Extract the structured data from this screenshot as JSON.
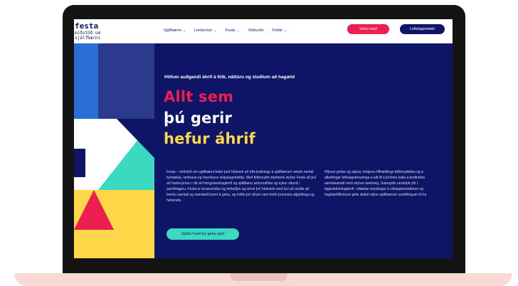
{
  "header": {
    "logo_title": "festa",
    "logo_subtitle_line1": "miðstöð um",
    "logo_subtitle_line2": "sjálfbærni",
    "nav": [
      {
        "label": "Sjálfbærni"
      },
      {
        "label": "Leiðarvísir"
      },
      {
        "label": "Festa"
      },
      {
        "label": "Viðburðir"
      },
      {
        "label": "Fréttir"
      }
    ],
    "join_button": "Vertu með",
    "climate_button": "Loftslagsmælir"
  },
  "hero": {
    "tagline": "Höfum auðgandi áhrif á fólk, náttúru og stuðlum að hagæld",
    "headline_line1": "Allt sem",
    "headline_line2": "þú gerir",
    "headline_line3": "hefur áhrif",
    "paragraph_left": "Festa – miðstöð um sjálfbærni hefur það hlutverk að efla þekkingu á sjálfbærum rekstri meðal fyrirtækja, stofnana og hverskyns skipulagsheilda. Með fjölbreyttri starfsemi styður Festa að því að hraða þróun í átt að hringrásarhagkerfi og sjálfbæru atvinnulífinu og eykur vitund í samfélaginu. Festa er brúarsmiður og leiðarljós og sinnir því hlutverki með því að stuðla að breiðu samtali og samstarfi þvert á geira, og miðla því áfram sem leiðir þróunina alþjóðlega og hérlendis.",
    "paragraph_right_lines": [
      "Hlýnun jarðar og sjávar, hnignun líffræðilegs fjölbreytileika og a",
      "afleiðingar loftslagsbreytinga á allt líf á jörðinni kalla á kraftmikla",
      "samtakamátt með skýran ásetning. Samspilin umskipti yfir í",
      "lágkolefnishagkerfi, róttækar breytingar á viðskiptamódelum og",
      "hagfræðilíkönum gefa skilað okkur sjálfbærum samfélögum til fra"
    ],
    "cta": "Sjáðu hvað þú getur gert"
  },
  "colors": {
    "navy": "#0e1566",
    "pink": "#ee1e50",
    "teal": "#3ad9c0",
    "yellow": "#ffd84a",
    "blue": "#2a6fd6"
  }
}
